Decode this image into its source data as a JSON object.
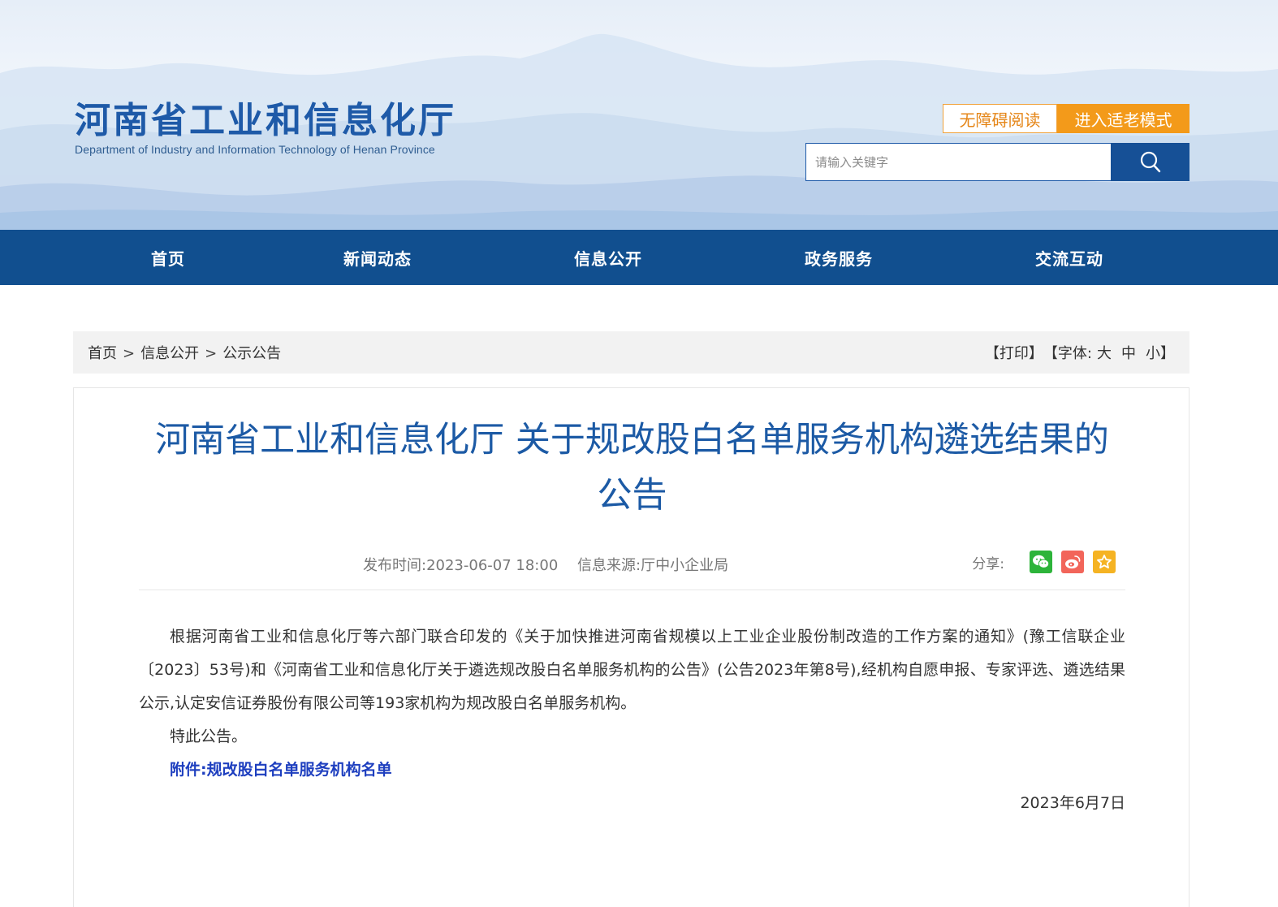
{
  "header": {
    "site_title": "河南省工业和信息化厅",
    "site_subtitle": "Department of Industry and Information Technology of Henan Province",
    "accessible_label": "无障碍阅读",
    "elder_mode_label": "进入适老模式",
    "search_placeholder": "请输入关键字"
  },
  "nav": {
    "items": [
      {
        "label": "首页"
      },
      {
        "label": "新闻动态"
      },
      {
        "label": "信息公开"
      },
      {
        "label": "政务服务"
      },
      {
        "label": "交流互动"
      }
    ]
  },
  "breadcrumb": {
    "items": [
      "首页",
      "信息公开",
      "公示公告"
    ],
    "separator": ">"
  },
  "tools": {
    "print": "【打印】",
    "font_prefix": "【字体:",
    "large": "大",
    "medium": "中",
    "small": "小",
    "font_suffix": "】"
  },
  "article": {
    "title_line1": "河南省工业和信息化厅 关于规改股白名单服务机构遴选结果的",
    "title_line2": "公告",
    "publish_time": "发布时间:2023-06-07 18:00",
    "source": "信息来源:厅中小企业局",
    "share_label": "分享:",
    "paragraph1": "根据河南省工业和信息化厅等六部门联合印发的《关于加快推进河南省规模以上工业企业股份制改造的工作方案的通知》(豫工信联企业〔2023〕53号)和《河南省工业和信息化厅关于遴选规改股白名单服务机构的公告》(公告2023年第8号),经机构自愿申报、专家评选、遴选结果公示,认定安信证券股份有限公司等193家机构为规改股白名单服务机构。",
    "paragraph2": "特此公告。",
    "attachment": "附件:规改股白名单服务机构名单",
    "date": "2023年6月7日"
  },
  "colors": {
    "brand_blue": "#114f8f",
    "title_blue": "#1c5aa5",
    "orange": "#f39a1a",
    "wechat_green": "#2db43a",
    "weibo_red": "#f2655a",
    "star_yellow": "#f5b323"
  },
  "icons": [
    "search-icon",
    "wechat-icon",
    "weibo-icon",
    "favorite-icon"
  ]
}
